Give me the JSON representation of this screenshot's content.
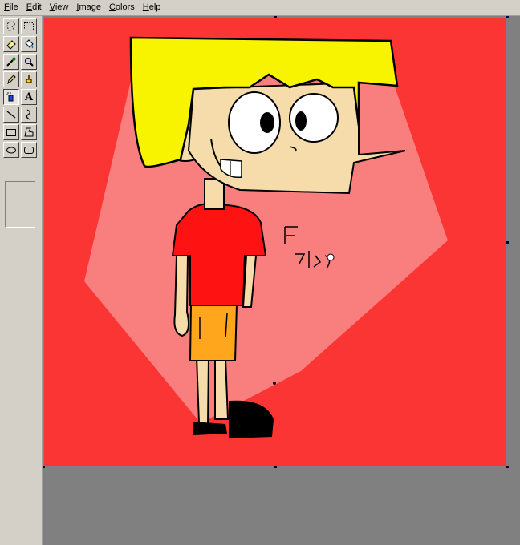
{
  "menu": {
    "items": [
      {
        "label": "File"
      },
      {
        "label": "Edit"
      },
      {
        "label": "View"
      },
      {
        "label": "Image"
      },
      {
        "label": "Colors"
      },
      {
        "label": "Help"
      }
    ]
  },
  "toolbox": {
    "tools": [
      {
        "name": "free-select-tool",
        "icon": "free-form-select-icon"
      },
      {
        "name": "rect-select-tool",
        "icon": "rect-select-icon"
      },
      {
        "name": "eraser-tool",
        "icon": "eraser-icon"
      },
      {
        "name": "fill-tool",
        "icon": "paint-bucket-icon"
      },
      {
        "name": "color-picker-tool",
        "icon": "eyedropper-icon"
      },
      {
        "name": "magnifier-tool",
        "icon": "magnifier-icon"
      },
      {
        "name": "pencil-tool",
        "icon": "pencil-icon"
      },
      {
        "name": "brush-tool",
        "icon": "brush-icon"
      },
      {
        "name": "airbrush-tool",
        "icon": "airbrush-icon"
      },
      {
        "name": "text-tool",
        "icon": "text-icon",
        "glyph": "A"
      },
      {
        "name": "line-tool",
        "icon": "line-icon"
      },
      {
        "name": "curve-tool",
        "icon": "curve-icon"
      },
      {
        "name": "rectangle-tool",
        "icon": "rectangle-icon"
      },
      {
        "name": "polygon-tool",
        "icon": "polygon-icon"
      },
      {
        "name": "ellipse-tool",
        "icon": "ellipse-icon"
      },
      {
        "name": "rounded-rect-tool",
        "icon": "rounded-rectangle-icon"
      }
    ],
    "active_tool": "airbrush-tool"
  },
  "canvas": {
    "background_color": "#fb3434",
    "drawing": {
      "spotlight_color": "#f97e7e",
      "hair_color": "#f8f400",
      "skin_color": "#f6dcaa",
      "shirt_color": "#ff1212",
      "shorts_color": "#ffa61c",
      "shoe_color": "#000000",
      "signature_description": "hand-scribbled signature"
    }
  }
}
